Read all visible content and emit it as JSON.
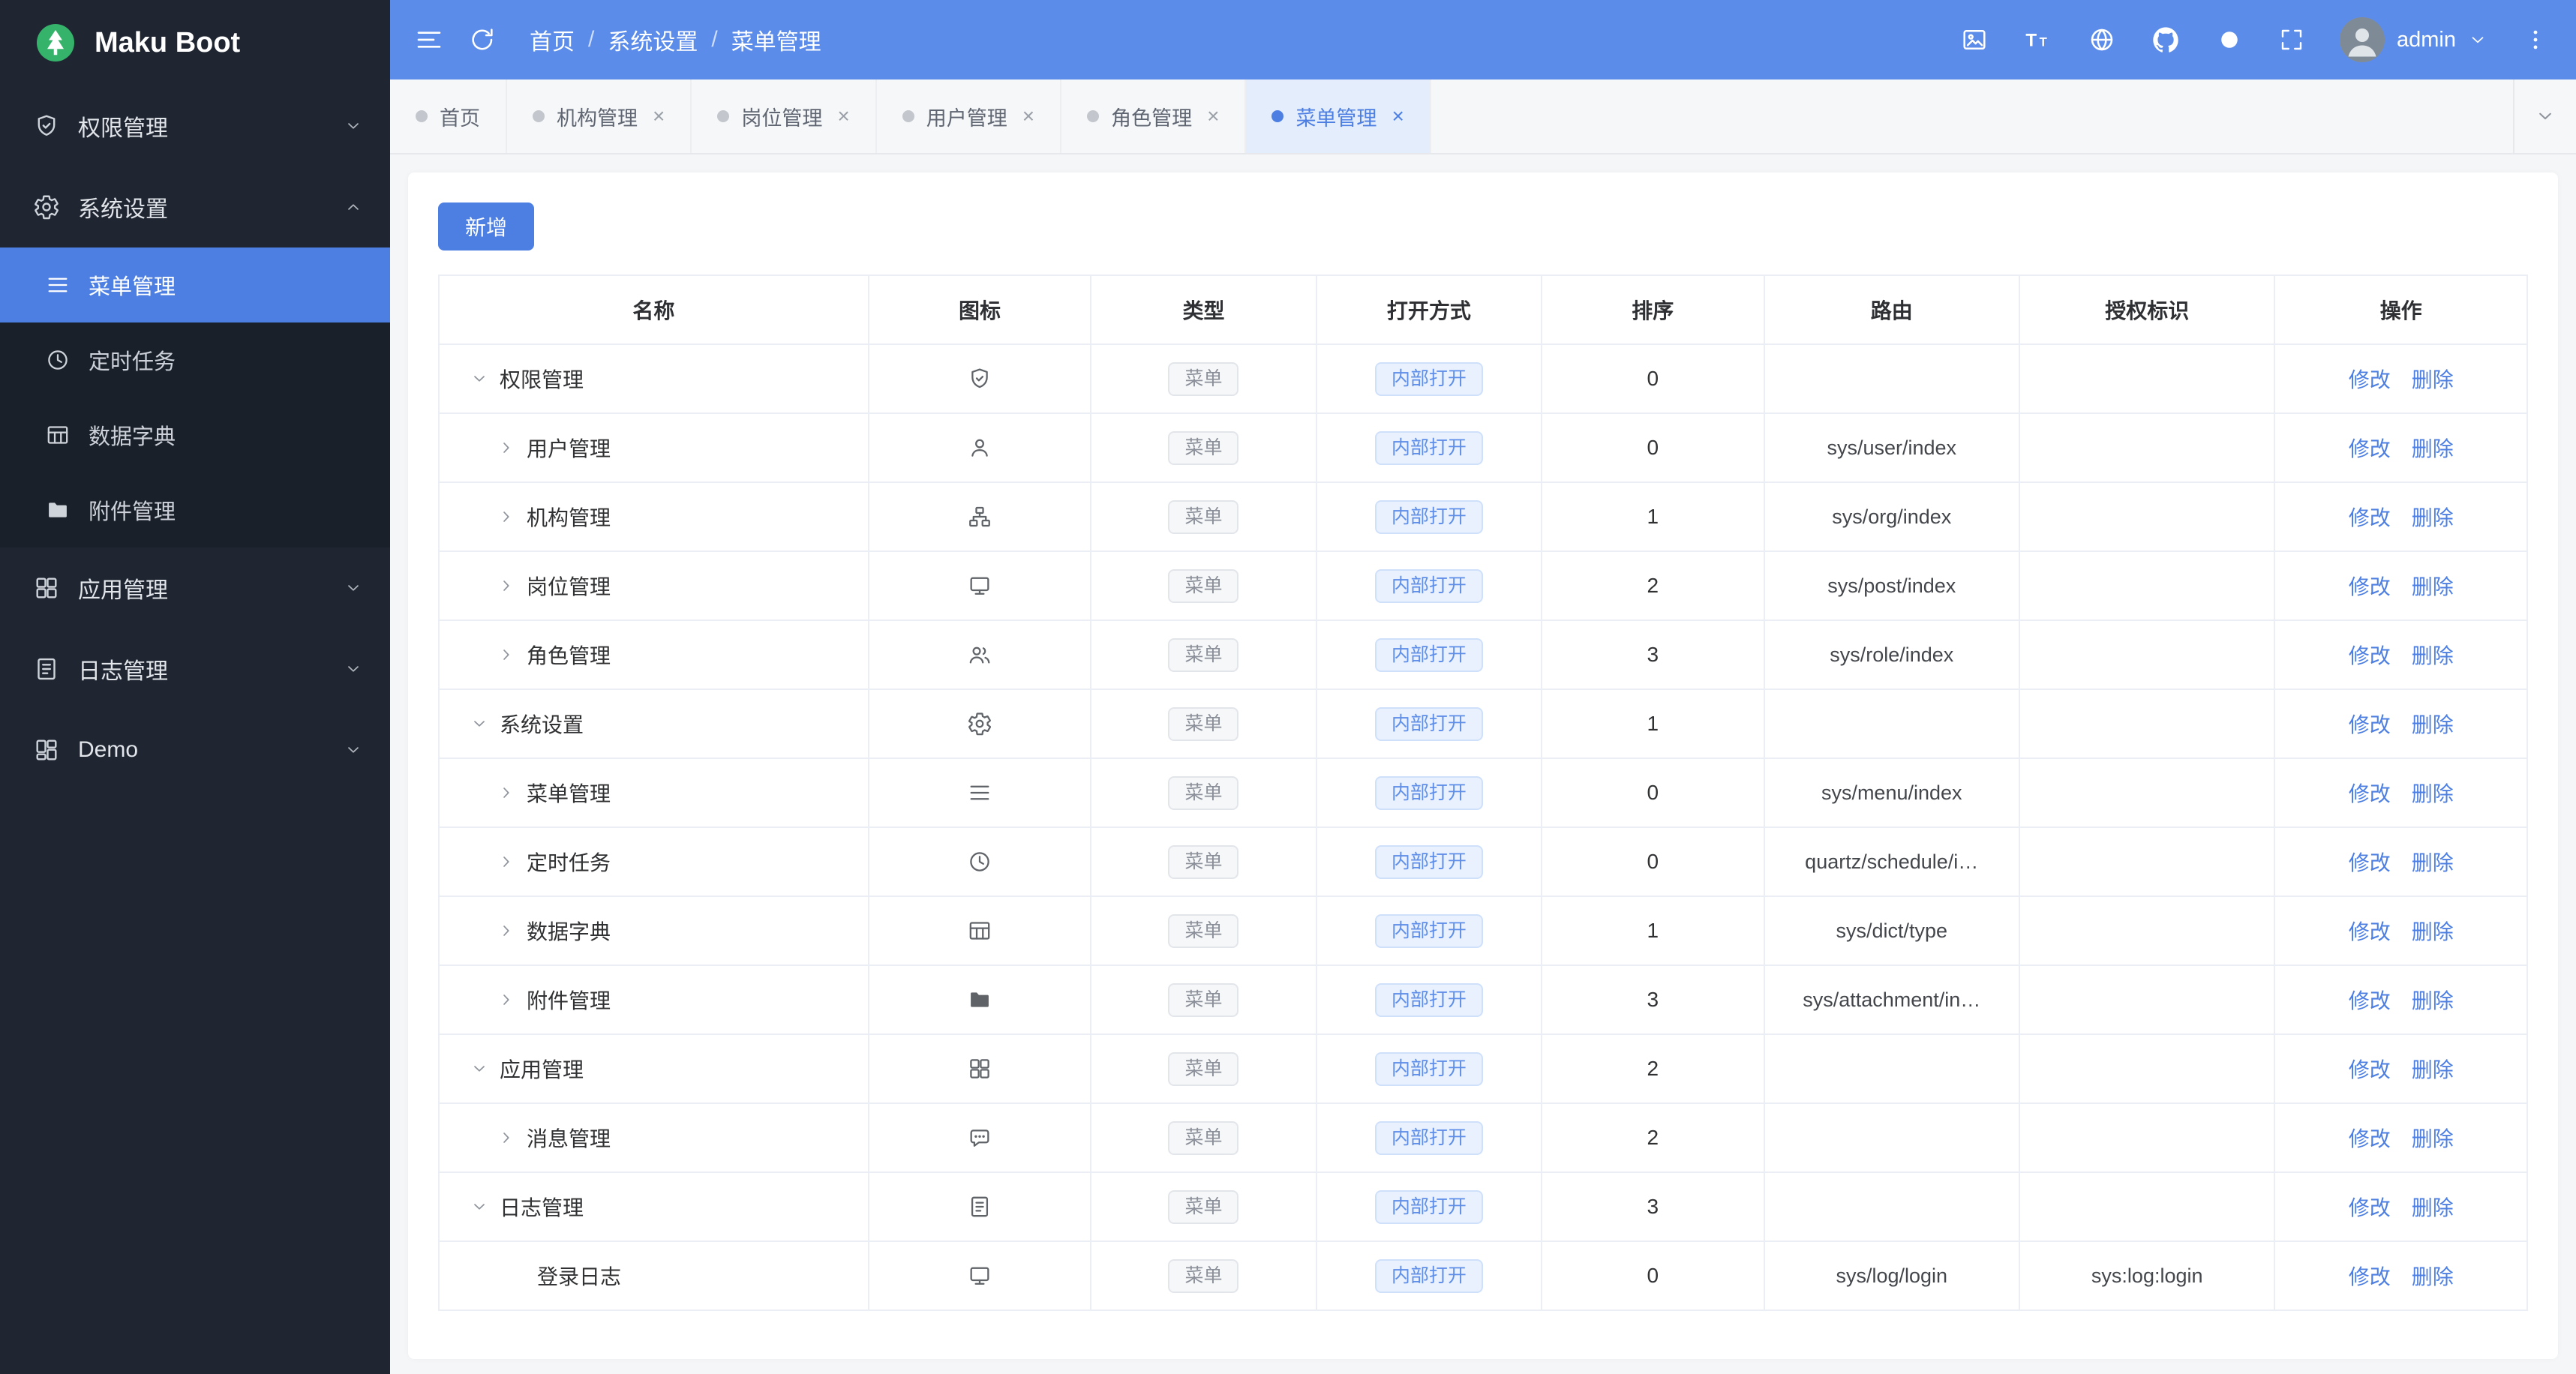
{
  "app": {
    "title": "Maku Boot"
  },
  "header": {
    "breadcrumb": [
      "首页",
      "系统设置",
      "菜单管理"
    ],
    "user": "admin"
  },
  "sidebar": {
    "items": [
      {
        "label": "权限管理",
        "icon": "shield",
        "expanded": false
      },
      {
        "label": "系统设置",
        "icon": "gear",
        "expanded": true,
        "children": [
          {
            "label": "菜单管理",
            "icon": "menu",
            "active": true
          },
          {
            "label": "定时任务",
            "icon": "clock",
            "active": false
          },
          {
            "label": "数据字典",
            "icon": "table",
            "active": false
          },
          {
            "label": "附件管理",
            "icon": "folder",
            "active": false
          }
        ]
      },
      {
        "label": "应用管理",
        "icon": "grid",
        "expanded": false
      },
      {
        "label": "日志管理",
        "icon": "doc",
        "expanded": false
      },
      {
        "label": "Demo",
        "icon": "demo",
        "expanded": false
      }
    ]
  },
  "tabs": [
    {
      "label": "首页",
      "closable": false,
      "active": false
    },
    {
      "label": "机构管理",
      "closable": true,
      "active": false
    },
    {
      "label": "岗位管理",
      "closable": true,
      "active": false
    },
    {
      "label": "用户管理",
      "closable": true,
      "active": false
    },
    {
      "label": "角色管理",
      "closable": true,
      "active": false
    },
    {
      "label": "菜单管理",
      "closable": true,
      "active": true
    }
  ],
  "toolbar": {
    "add_label": "新增"
  },
  "table": {
    "columns": [
      "名称",
      "图标",
      "类型",
      "打开方式",
      "排序",
      "路由",
      "授权标识",
      "操作"
    ],
    "tag_type": "菜单",
    "tag_open": "内部打开",
    "actions": {
      "edit": "修改",
      "delete": "删除"
    },
    "rows": [
      {
        "name": "权限管理",
        "level": 0,
        "chevron": "down",
        "icon": "shield",
        "sort": "0",
        "route": "",
        "perm": ""
      },
      {
        "name": "用户管理",
        "level": 1,
        "chevron": "right",
        "icon": "user",
        "sort": "0",
        "route": "sys/user/index",
        "perm": ""
      },
      {
        "name": "机构管理",
        "level": 1,
        "chevron": "right",
        "icon": "org",
        "sort": "1",
        "route": "sys/org/index",
        "perm": ""
      },
      {
        "name": "岗位管理",
        "level": 1,
        "chevron": "right",
        "icon": "monitor",
        "sort": "2",
        "route": "sys/post/index",
        "perm": ""
      },
      {
        "name": "角色管理",
        "level": 1,
        "chevron": "right",
        "icon": "role",
        "sort": "3",
        "route": "sys/role/index",
        "perm": ""
      },
      {
        "name": "系统设置",
        "level": 0,
        "chevron": "down",
        "icon": "gear",
        "sort": "1",
        "route": "",
        "perm": ""
      },
      {
        "name": "菜单管理",
        "level": 1,
        "chevron": "right",
        "icon": "menu",
        "sort": "0",
        "route": "sys/menu/index",
        "perm": ""
      },
      {
        "name": "定时任务",
        "level": 1,
        "chevron": "right",
        "icon": "clock",
        "sort": "0",
        "route": "quartz/schedule/i…",
        "perm": ""
      },
      {
        "name": "数据字典",
        "level": 1,
        "chevron": "right",
        "icon": "table",
        "sort": "1",
        "route": "sys/dict/type",
        "perm": ""
      },
      {
        "name": "附件管理",
        "level": 1,
        "chevron": "right",
        "icon": "folder",
        "sort": "3",
        "route": "sys/attachment/in…",
        "perm": ""
      },
      {
        "name": "应用管理",
        "level": 0,
        "chevron": "down",
        "icon": "grid",
        "sort": "2",
        "route": "",
        "perm": ""
      },
      {
        "name": "消息管理",
        "level": 1,
        "chevron": "right",
        "icon": "message",
        "sort": "2",
        "route": "",
        "perm": ""
      },
      {
        "name": "日志管理",
        "level": 0,
        "chevron": "down",
        "icon": "doc",
        "sort": "3",
        "route": "",
        "perm": ""
      },
      {
        "name": "登录日志",
        "level": 1,
        "chevron": "none",
        "icon": "monitor",
        "sort": "0",
        "route": "sys/log/login",
        "perm": "sys:log:login"
      }
    ]
  },
  "colors": {
    "primary": "#4d7fe3",
    "topbar": "#5b8cea",
    "sidebar_bg": "#1f2632",
    "active_tab_bg": "#e4edfc",
    "logo_green": "#35b36b"
  }
}
